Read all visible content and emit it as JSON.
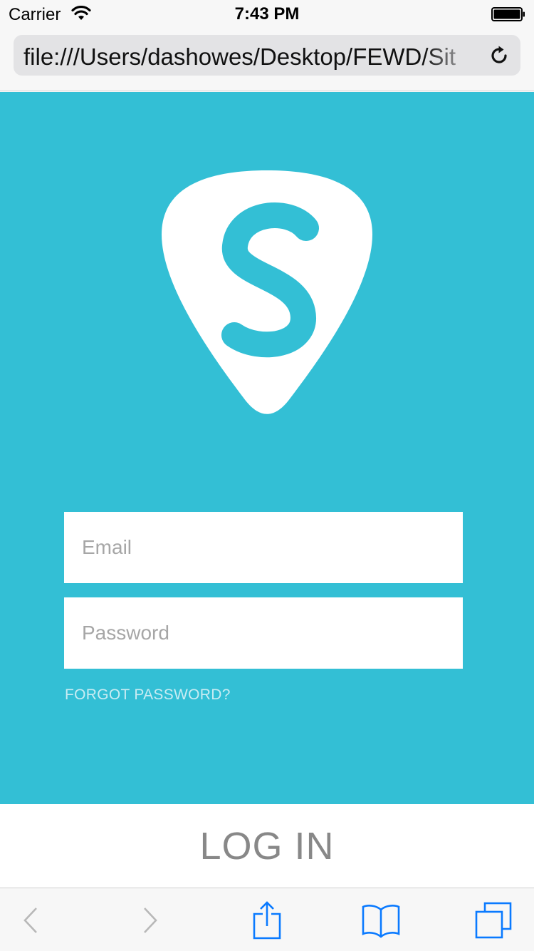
{
  "colors": {
    "brand_teal": "#33bfd5",
    "ios_blue": "#0a7aff",
    "login_text": "#888888",
    "forgot_text": "#c9ecf3"
  },
  "status_bar": {
    "carrier": "Carrier",
    "time": "7:43 PM",
    "icons": [
      "wifi-icon",
      "battery-icon"
    ]
  },
  "browser": {
    "url": "file:///Users/dashowes/Desktop/FEWD/Sit",
    "reload_icon": "reload-icon"
  },
  "app": {
    "logo_icon": "guitar-pick-s-logo",
    "email": {
      "value": "",
      "placeholder": "Email"
    },
    "password": {
      "value": "",
      "placeholder": "Password"
    },
    "forgot_label": "FORGOT PASSWORD?",
    "login_label": "LOG IN"
  },
  "toolbar": {
    "items": [
      "back-icon",
      "forward-icon",
      "share-icon",
      "bookmarks-icon",
      "tabs-icon"
    ]
  }
}
